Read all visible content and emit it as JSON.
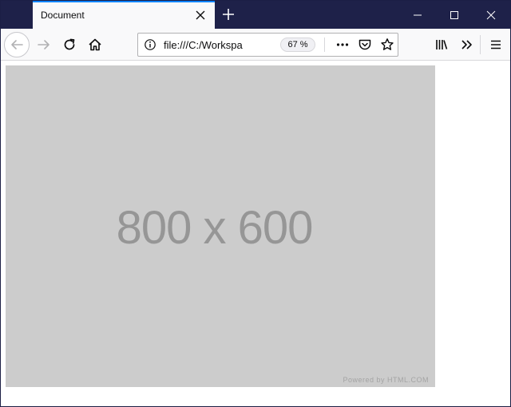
{
  "tab": {
    "title": "Document"
  },
  "address": {
    "url": "file:///C:/Workspa",
    "zoom": "67 %"
  },
  "content": {
    "placeholder_text": "800 x 600",
    "credit": "Powered by HTML.COM"
  },
  "icons": {
    "tab_close": "close-icon",
    "new_tab": "plus-icon",
    "minimize": "minimize-icon",
    "maximize": "maximize-icon",
    "close_window": "close-icon",
    "back": "back-arrow-icon",
    "forward": "forward-arrow-icon",
    "reload": "reload-icon",
    "home": "home-icon",
    "info": "info-icon",
    "more": "ellipsis-icon",
    "pocket": "pocket-icon",
    "bookmark": "star-icon",
    "library": "library-icon",
    "overflow": "chevron-double-right-icon",
    "menu": "hamburger-menu-icon"
  },
  "colors": {
    "titlebar": "#1e2149",
    "tab_accent": "#0a84ff",
    "toolbar": "#f9f9fa",
    "placeholder_bg": "#cccccc",
    "placeholder_text": "#969696"
  }
}
